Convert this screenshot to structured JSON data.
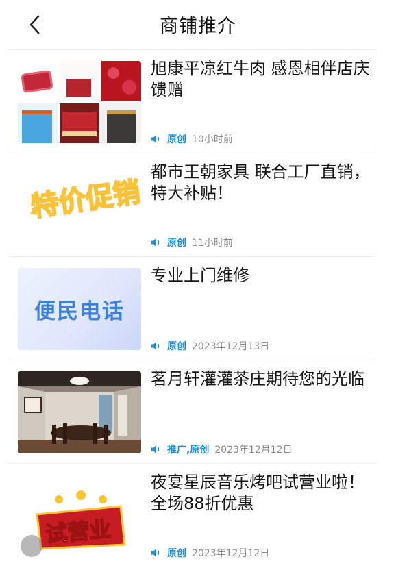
{
  "header": {
    "title": "商铺推介",
    "back_icon": "chevron-left-icon"
  },
  "colors": {
    "tag": "#1c8fe0",
    "time": "#8a8a8a",
    "speaker_icon": "#1c8fe0"
  },
  "items": [
    {
      "title": "旭康平凉红牛肉 感恩相伴店庆馈赠",
      "tag": "原创",
      "time": "10小时前",
      "thumb_icon": "beef-products-collage"
    },
    {
      "title": "都市王朝家具  联合工厂直销，特大补贴！",
      "tag": "原创",
      "time": "11小时前",
      "thumb_text": "特价促销"
    },
    {
      "title": "专业上门维修",
      "tag": "原创",
      "time": "2023年12月13日",
      "thumb_text": "便民电话"
    },
    {
      "title": "茗月轩灌灌茶庄期待您的光临",
      "tag": "推广,原创",
      "time": "2023年12月12日",
      "thumb_icon": "tea-room-photo"
    },
    {
      "title": "夜宴星辰音乐烤吧试营业啦！全场88折优惠",
      "tag": "原创",
      "time": "2023年12月12日",
      "thumb_text": "试营业"
    }
  ]
}
